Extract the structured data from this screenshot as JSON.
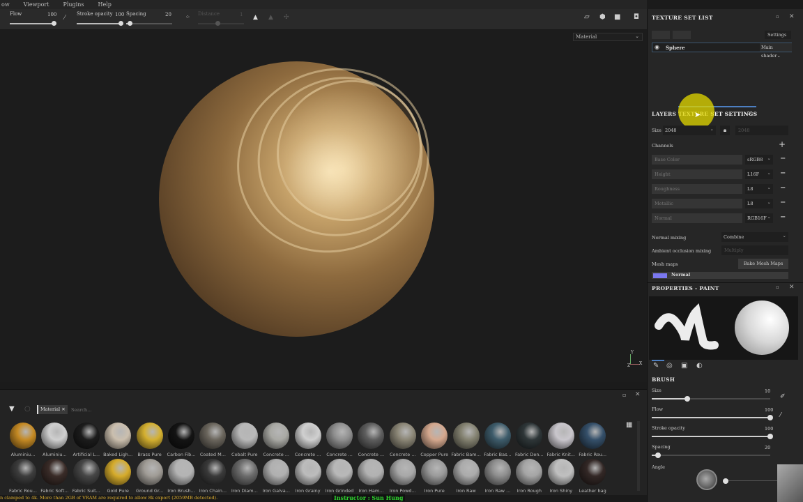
{
  "menu": [
    "ow",
    "Viewport",
    "Plugins",
    "Help"
  ],
  "toolbar": {
    "flow_label": "Flow",
    "flow_value": "100",
    "stroke_opacity_label": "Stroke opacity",
    "stroke_opacity_value": "100",
    "spacing_label": "Spacing",
    "spacing_value": "20",
    "distance_label": "Distance",
    "distance_value": "1"
  },
  "viewport": {
    "material_mode": "Material",
    "axis_x": "X",
    "axis_y": "Y",
    "axis_z": "Z"
  },
  "texture_set_list": {
    "title": "TEXTURE SET LIST",
    "settings_label": "Settings",
    "set_name": "Sphere",
    "shader": "Main shader"
  },
  "tabs": {
    "layers": "LAYERS",
    "texture_set_settings": "TEXTURE SET SETTINGS"
  },
  "tss": {
    "size_label": "Size",
    "size_value": "2048",
    "size_value2": "2048",
    "channels_label": "Channels",
    "channels": [
      {
        "name": "Base Color",
        "format": "sRGB8"
      },
      {
        "name": "Height",
        "format": "L16F"
      },
      {
        "name": "Roughness",
        "format": "L8"
      },
      {
        "name": "Metallic",
        "format": "L8"
      },
      {
        "name": "Normal",
        "format": "RGB16F"
      }
    ],
    "normal_mixing_label": "Normal mixing",
    "normal_mixing_value": "Combine",
    "ao_mixing_label": "Ambient occlusion mixing",
    "ao_mixing_value": "Multiply",
    "mesh_maps_label": "Mesh maps",
    "bake_button": "Bake Mesh Maps",
    "mesh_map_normal": "Normal",
    "normal_color": "#7b78f0"
  },
  "properties": {
    "title": "PROPERTIES - PAINT",
    "brush_section": "BRUSH",
    "size_label": "Size",
    "size_value": "10",
    "size_fraction": 0.3,
    "flow_label": "Flow",
    "flow_value": "100",
    "flow_fraction": 1.0,
    "stroke_opacity_label": "Stroke opacity",
    "stroke_opacity_value": "100",
    "stroke_opacity_fraction": 1.0,
    "spacing_label": "Spacing",
    "spacing_value": "20",
    "spacing_fraction": 0.05,
    "angle_label": "Angle"
  },
  "shelf": {
    "filter_tag": "Material",
    "search_placeholder": "Search...",
    "row1": [
      {
        "name": "Aluminiu...",
        "color": "#c58a24"
      },
      {
        "name": "Aluminiu...",
        "color": "#cfcfcf"
      },
      {
        "name": "Artificial L...",
        "color": "#1c1c1c"
      },
      {
        "name": "Baked Ligh...",
        "color": "#cbbfae"
      },
      {
        "name": "Brass Pure",
        "color": "#d4b030"
      },
      {
        "name": "Carbon Fib...",
        "color": "#141414"
      },
      {
        "name": "Coated M...",
        "color": "#6b665d"
      },
      {
        "name": "Cobalt Pure",
        "color": "#b8b8b8"
      },
      {
        "name": "Concrete ...",
        "color": "#a9a9a4"
      },
      {
        "name": "Concrete ...",
        "color": "#d0d0d0"
      },
      {
        "name": "Concrete ...",
        "color": "#8f8f8f"
      },
      {
        "name": "Concrete ...",
        "color": "#5e5e5e"
      },
      {
        "name": "Concrete ...",
        "color": "#8b8676"
      },
      {
        "name": "Copper Pure",
        "color": "#d4a88e"
      },
      {
        "name": "Fabric Bam...",
        "color": "#838170"
      },
      {
        "name": "Fabric Bas...",
        "color": "#3e5c6b"
      },
      {
        "name": "Fabric Den...",
        "color": "#2e3638"
      },
      {
        "name": "Fabric Knit...",
        "color": "#c9c6cc"
      },
      {
        "name": "Fabric Rou...",
        "color": "#35506a"
      }
    ],
    "row2": [
      {
        "name": "Fabric Rou...",
        "color": "#3d3d3d"
      },
      {
        "name": "Fabric Soft...",
        "color": "#3a2c28"
      },
      {
        "name": "Fabric Suit...",
        "color": "#474747"
      },
      {
        "name": "Gold Pure",
        "color": "#d6ac2c"
      },
      {
        "name": "Ground Gr...",
        "color": "#a09c96"
      },
      {
        "name": "Iron Brush...",
        "color": "#b4b4b4"
      },
      {
        "name": "Iron Chain...",
        "color": "#3a3a3a"
      },
      {
        "name": "Iron Diam...",
        "color": "#6c6c6c"
      },
      {
        "name": "Iron Galva...",
        "color": "#b0b0b0"
      },
      {
        "name": "Iron Grainy",
        "color": "#bcbcbc"
      },
      {
        "name": "Iron Grinded",
        "color": "#b8b8b8"
      },
      {
        "name": "Iron Ham...",
        "color": "#b2b2b2"
      },
      {
        "name": "Iron Powd...",
        "color": "#a8a8a8"
      },
      {
        "name": "Iron Pure",
        "color": "#9a9a9a"
      },
      {
        "name": "Iron Raw",
        "color": "#ababab"
      },
      {
        "name": "Iron Raw ...",
        "color": "#8e8e8e"
      },
      {
        "name": "Iron Rough",
        "color": "#a5a5a5"
      },
      {
        "name": "Iron Shiny",
        "color": "#c0c0c0"
      },
      {
        "name": "Leather bag",
        "color": "#332826"
      }
    ]
  },
  "status": {
    "message": "n clamped to 4k. More than 2GB of VRAM are required to allow 8k export (2059MB detected).",
    "instructor": "Instructor : Sun Hung"
  }
}
